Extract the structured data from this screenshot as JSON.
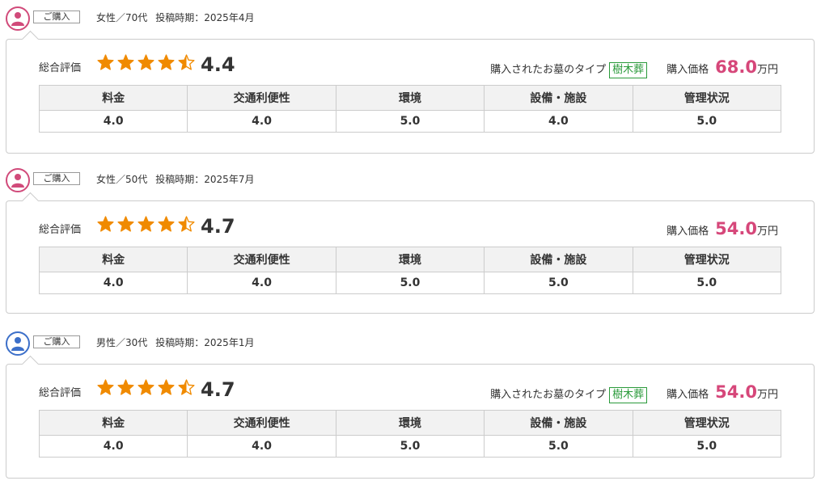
{
  "colors": {
    "accent_pink": "#d6477a",
    "tag_green": "#2a9a3a",
    "star_orange": "#f08a00",
    "female_avatar": "#d14a7a",
    "male_avatar": "#3c6fc9"
  },
  "labels": {
    "badge": "ご購入",
    "overall": "総合評価",
    "grave_type": "購入されたお墓のタイプ",
    "price": "購入価格",
    "price_unit": "万円"
  },
  "columns": [
    "料金",
    "交通利便性",
    "環境",
    "設備・施設",
    "管理状況"
  ],
  "reviews": [
    {
      "avatar_icon": "user-icon-female",
      "author": "女性／70代",
      "posted": "投稿時期：2025年4月",
      "score": "4.4",
      "stars": 4.4,
      "grave_type": "樹木葬",
      "price": "68.0",
      "ratings": [
        "4.0",
        "4.0",
        "5.0",
        "4.0",
        "5.0"
      ]
    },
    {
      "avatar_icon": "user-icon-female",
      "author": "女性／50代",
      "posted": "投稿時期：2025年7月",
      "score": "4.7",
      "stars": 4.7,
      "grave_type": null,
      "price": "54.0",
      "ratings": [
        "4.0",
        "4.0",
        "5.0",
        "5.0",
        "5.0"
      ]
    },
    {
      "avatar_icon": "user-icon-male",
      "author": "男性／30代",
      "posted": "投稿時期：2025年1月",
      "score": "4.7",
      "stars": 4.7,
      "grave_type": "樹木葬",
      "price": "54.0",
      "ratings": [
        "4.0",
        "4.0",
        "5.0",
        "5.0",
        "5.0"
      ]
    }
  ]
}
